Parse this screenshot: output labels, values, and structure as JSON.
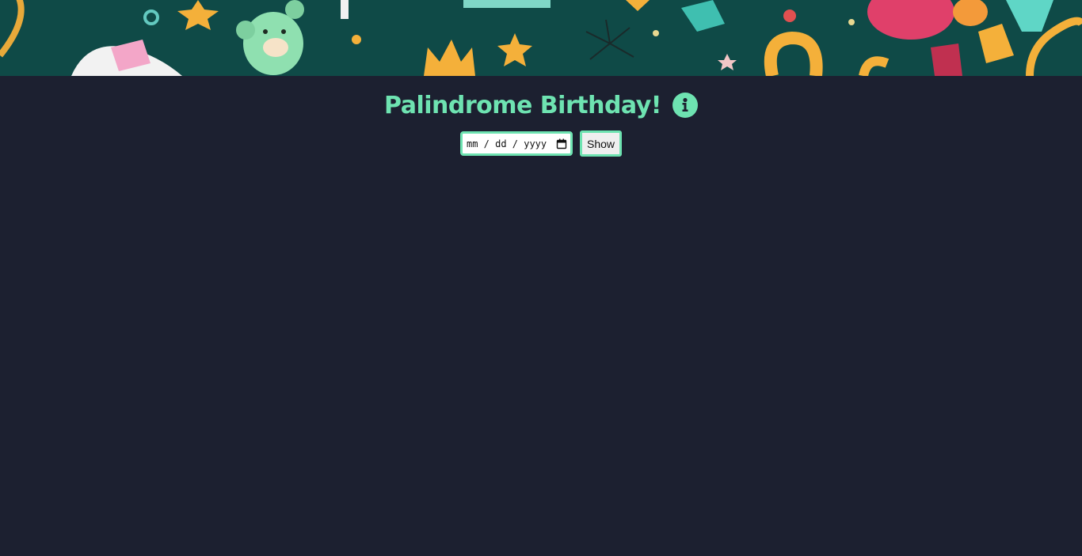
{
  "header": {
    "title": "Palindrome Birthday!",
    "info_icon": "info-icon"
  },
  "form": {
    "date_placeholder": "mm / dd / yyyy",
    "date_value": "",
    "calendar_icon": "calendar-icon",
    "show_label": "Show"
  },
  "colors": {
    "background": "#1c2030",
    "accent": "#6ee3b1",
    "banner_base": "#0f4a47"
  }
}
